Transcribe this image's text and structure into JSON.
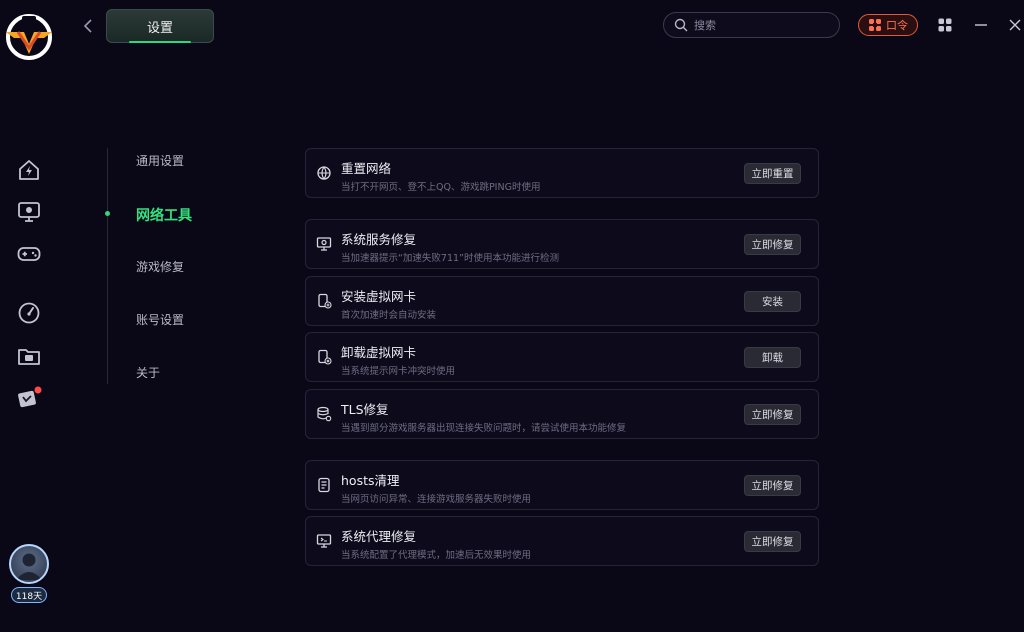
{
  "header": {
    "title": "设置",
    "search_placeholder": "搜索",
    "kouling_label": "口令"
  },
  "colors": {
    "accent": "#35e07f",
    "background": "#0a0816",
    "kouling": "#ff7052"
  },
  "rail": {
    "icons": [
      "boost-home-icon",
      "monitor-icon",
      "gamepad-icon",
      "speedometer-icon",
      "folder-icon",
      "game-card-icon"
    ],
    "vip_days": "118天"
  },
  "menu": {
    "items": [
      {
        "label": "通用设置",
        "active": false
      },
      {
        "label": "网络工具",
        "active": true
      },
      {
        "label": "游戏修复",
        "active": false
      },
      {
        "label": "账号设置",
        "active": false
      },
      {
        "label": "关于",
        "active": false
      }
    ]
  },
  "tools": [
    {
      "title": "重置网络",
      "desc": "当打不开网页、登不上QQ、游戏跳PING时使用",
      "button": "立即重置",
      "icon": "globe-reset-icon"
    },
    {
      "title": "系统服务修复",
      "desc": "当加速器提示“加速失败711”时使用本功能进行检测",
      "button": "立即修复",
      "icon": "system-service-icon"
    },
    {
      "title": "安装虚拟网卡",
      "desc": "首次加速时会自动安装",
      "button": "安装",
      "icon": "network-card-install-icon"
    },
    {
      "title": "卸载虚拟网卡",
      "desc": "当系统提示网卡冲突时使用",
      "button": "卸载",
      "icon": "network-card-uninstall-icon"
    },
    {
      "title": "TLS修复",
      "desc": "当遇到部分游戏服务器出现连接失败问题时，请尝试使用本功能修复",
      "button": "立即修复",
      "icon": "database-gear-icon"
    },
    {
      "title": "hosts清理",
      "desc": "当网页访问异常、连接游戏服务器失败时使用",
      "button": "立即修复",
      "icon": "hosts-file-icon"
    },
    {
      "title": "系统代理修复",
      "desc": "当系统配置了代理模式，加速后无效果时使用",
      "button": "立即修复",
      "icon": "proxy-monitor-icon"
    }
  ]
}
